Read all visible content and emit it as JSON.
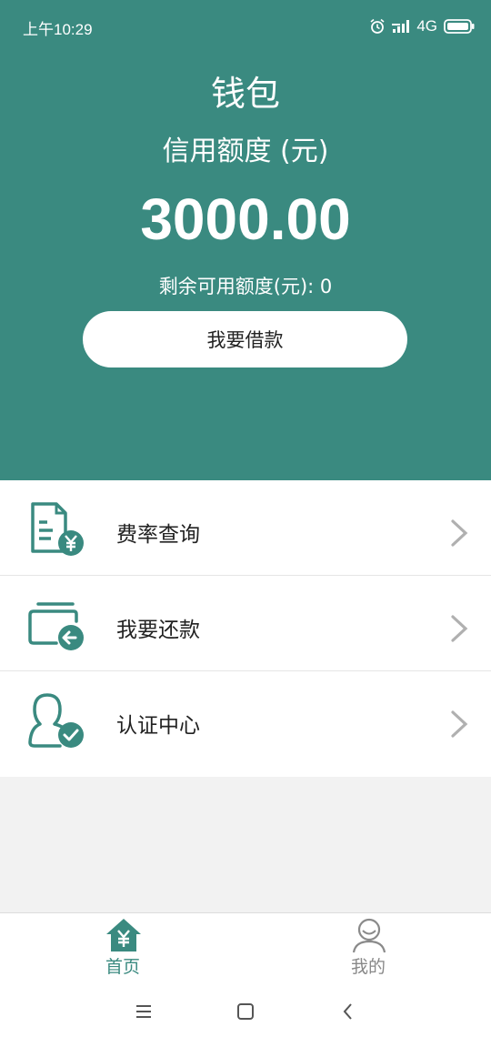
{
  "status_bar": {
    "time": "上午10:29",
    "network": "4G"
  },
  "header": {
    "title": "钱包",
    "subtitle": "信用额度 (元)",
    "amount": "3000.00",
    "remaining": "剩余可用额度(元): 0",
    "borrow_button": "我要借款"
  },
  "menu": {
    "items": [
      {
        "label": "费率查询",
        "icon": "rate-document-icon"
      },
      {
        "label": "我要还款",
        "icon": "repay-wallet-icon"
      },
      {
        "label": "认证中心",
        "icon": "verified-user-icon"
      }
    ]
  },
  "tabbar": {
    "home_label": "首页",
    "mine_label": "我的"
  },
  "colors": {
    "primary": "#3a8a80",
    "background": "#f2f2f2"
  }
}
